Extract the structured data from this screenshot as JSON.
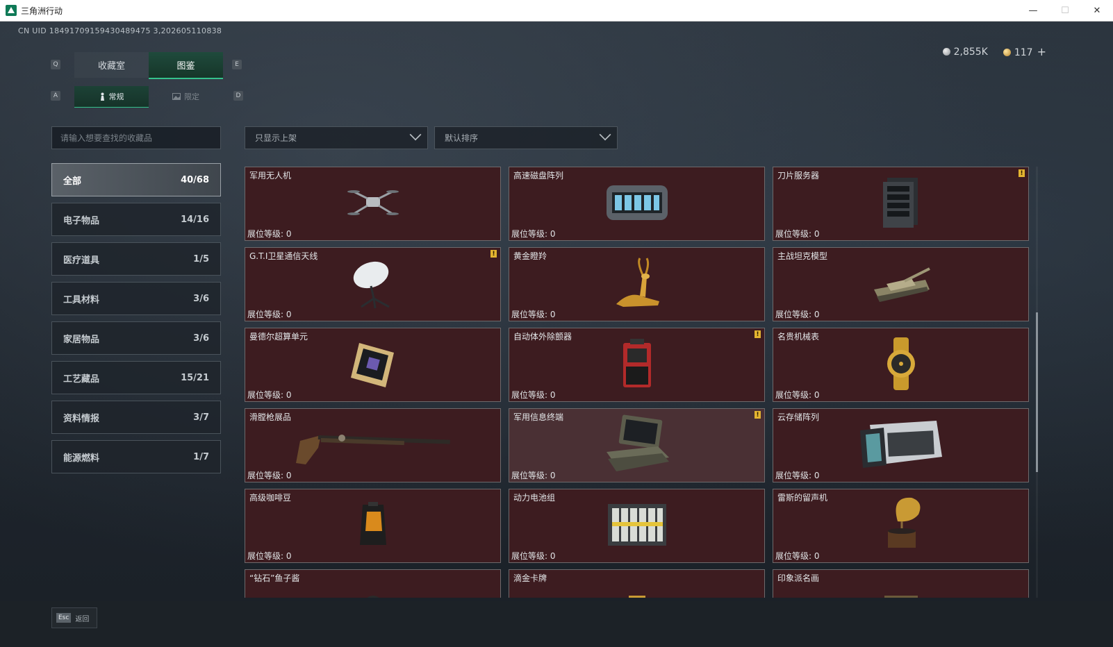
{
  "window": {
    "title": "三角洲行动",
    "minimize": "—",
    "maximize": "☐",
    "close": "✕"
  },
  "header": {
    "uid": "CN UID 18491709159430489475 3,202605110838"
  },
  "currency": [
    {
      "type": "silver",
      "value": "2,855K"
    },
    {
      "type": "gold",
      "value": "117",
      "plus": "+"
    }
  ],
  "keys": {
    "q": "Q",
    "e": "E",
    "a": "A",
    "d": "D"
  },
  "tabs": [
    {
      "label": "收藏室",
      "active": false
    },
    {
      "label": "图鉴",
      "active": true
    }
  ],
  "subtabs": [
    {
      "label": "常规",
      "icon": "figure-icon",
      "active": true
    },
    {
      "label": "限定",
      "icon": "image-icon",
      "active": false
    }
  ],
  "search": {
    "placeholder": "请输入想要查找的收藏品"
  },
  "filters": [
    {
      "label": "只显示上架"
    },
    {
      "label": "默认排序"
    }
  ],
  "categories": [
    {
      "label": "全部",
      "count": "40/68",
      "active": true
    },
    {
      "label": "电子物品",
      "count": "14/16"
    },
    {
      "label": "医疗道具",
      "count": "1/5"
    },
    {
      "label": "工具材料",
      "count": "3/6"
    },
    {
      "label": "家居物品",
      "count": "3/6"
    },
    {
      "label": "工艺藏品",
      "count": "15/21"
    },
    {
      "label": "资料情报",
      "count": "3/7"
    },
    {
      "label": "能源燃料",
      "count": "1/7"
    }
  ],
  "level_label": "展位等级: 0",
  "items": [
    {
      "name": "军用无人机",
      "alert": false,
      "icon": "drone-icon"
    },
    {
      "name": "高速磁盘阵列",
      "alert": false,
      "icon": "disk-array-icon"
    },
    {
      "name": "刀片服务器",
      "alert": true,
      "icon": "server-icon"
    },
    {
      "name": "G.T.I卫星通信天线",
      "alert": true,
      "icon": "satellite-dish-icon"
    },
    {
      "name": "黄金瞪羚",
      "alert": false,
      "icon": "golden-gazelle-icon"
    },
    {
      "name": "主战坦克模型",
      "alert": false,
      "icon": "tank-model-icon"
    },
    {
      "name": "曼德尔超算单元",
      "alert": false,
      "icon": "supercomputer-unit-icon"
    },
    {
      "name": "自动体外除颤器",
      "alert": true,
      "icon": "defibrillator-icon"
    },
    {
      "name": "名贵机械表",
      "alert": false,
      "icon": "watch-icon"
    },
    {
      "name": "滑膛枪展品",
      "alert": false,
      "icon": "musket-icon"
    },
    {
      "name": "军用信息终端",
      "alert": true,
      "icon": "laptop-case-icon",
      "highlight": true
    },
    {
      "name": "云存储阵列",
      "alert": false,
      "icon": "cloud-storage-icon"
    },
    {
      "name": "高级咖啡豆",
      "alert": false,
      "icon": "coffee-bag-icon"
    },
    {
      "name": "动力电池组",
      "alert": false,
      "icon": "battery-pack-icon"
    },
    {
      "name": "雷斯的留声机",
      "alert": false,
      "icon": "gramophone-icon"
    },
    {
      "name": "“钻石”鱼子酱",
      "alert": false,
      "icon": "caviar-icon"
    },
    {
      "name": "滴金卡牌",
      "alert": false,
      "icon": "card-icon"
    },
    {
      "name": "印象派名画",
      "alert": false,
      "icon": "painting-icon"
    }
  ],
  "alert_glyph": "!",
  "footer": {
    "esc_key": "Esc",
    "back_label": "返回"
  }
}
